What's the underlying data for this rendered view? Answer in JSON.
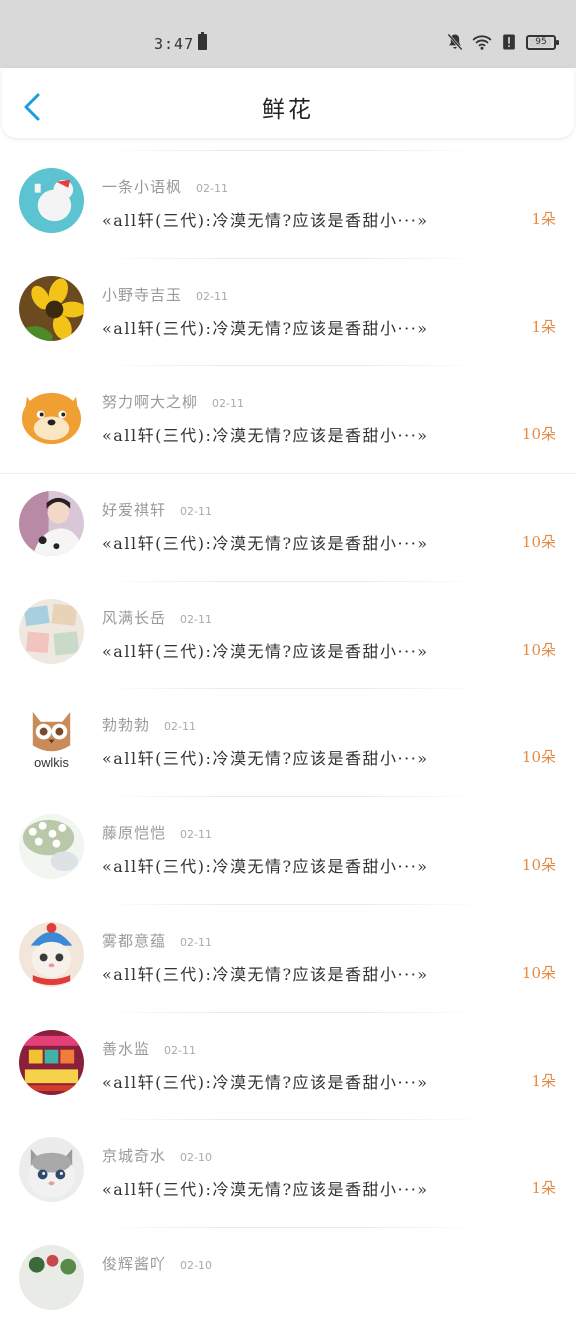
{
  "status_bar": {
    "time": "3:47",
    "battery_level": "95"
  },
  "header": {
    "title": "鲜花"
  },
  "items": [
    {
      "username": "一条小语枫",
      "date": "02-11",
      "message": "«all轩(三代):冷漠无情?应该是香甜小···»",
      "count": "1朵"
    },
    {
      "username": "小野寺吉玉",
      "date": "02-11",
      "message": "«all轩(三代):冷漠无情?应该是香甜小···»",
      "count": "1朵"
    },
    {
      "username": "努力啊大之柳",
      "date": "02-11",
      "message": "«all轩(三代):冷漠无情?应该是香甜小···»",
      "count": "10朵"
    },
    {
      "username": "好爱祺轩",
      "date": "02-11",
      "message": "«all轩(三代):冷漠无情?应该是香甜小···»",
      "count": "10朵"
    },
    {
      "username": "风满长岳",
      "date": "02-11",
      "message": "«all轩(三代):冷漠无情?应该是香甜小···»",
      "count": "10朵"
    },
    {
      "username": "勃勃勃",
      "date": "02-11",
      "message": "«all轩(三代):冷漠无情?应该是香甜小···»",
      "count": "10朵"
    },
    {
      "username": "藤原恺恺",
      "date": "02-11",
      "message": "«all轩(三代):冷漠无情?应该是香甜小···»",
      "count": "10朵"
    },
    {
      "username": "雾都意蕴",
      "date": "02-11",
      "message": "«all轩(三代):冷漠无情?应该是香甜小···»",
      "count": "10朵"
    },
    {
      "username": "善水监",
      "date": "02-11",
      "message": "«all轩(三代):冷漠无情?应该是香甜小···»",
      "count": "1朵"
    },
    {
      "username": "京城奇水",
      "date": "02-10",
      "message": "«all轩(三代):冷漠无情?应该是香甜小···»",
      "count": "1朵"
    },
    {
      "username": "俊辉酱吖",
      "date": "02-10",
      "message": "",
      "count": ""
    }
  ],
  "avatar_logo_text": "owlkis",
  "colors": {
    "accent_blue": "#1e9be0",
    "count_orange": "#e58a43",
    "status_bar_bg": "#d9d9d9"
  }
}
